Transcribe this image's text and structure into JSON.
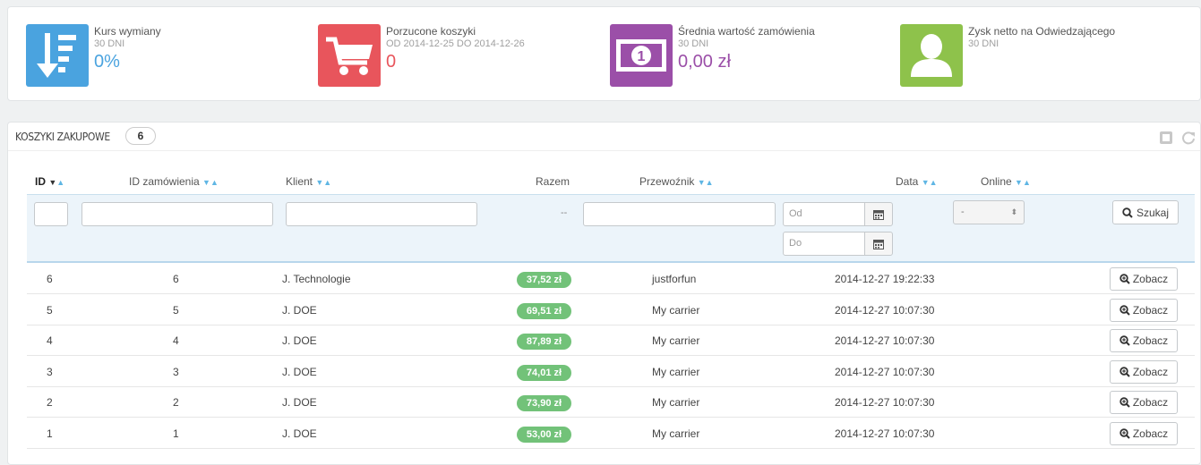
{
  "kpis": [
    {
      "title": "Kurs wymiany",
      "sub": "30 DNI",
      "value": "0%",
      "icon": "sort-down-icon",
      "color": "#4aa3df"
    },
    {
      "title": "Porzucone koszyki",
      "sub": "OD 2014-12-25 DO 2014-12-26",
      "value": "0",
      "icon": "shopping-cart-icon",
      "color": "#e8555c"
    },
    {
      "title": "Średnia wartość zamówienia",
      "sub": "30 DNI",
      "value": "0,00 zł",
      "icon": "money-icon",
      "color": "#9b4fa8"
    },
    {
      "title": "Zysk netto na Odwiedzającego",
      "sub": "30 DNI",
      "value": "",
      "icon": "user-icon",
      "color": "#8ec24b"
    }
  ],
  "panel": {
    "title": "KOSZYKI ZAKUPOWE",
    "count": "6"
  },
  "columns": {
    "id": "ID",
    "order_id": "ID zamówienia",
    "customer": "Klient",
    "total": "Razem",
    "carrier": "Przewoźnik",
    "date": "Data",
    "online": "Online"
  },
  "filters": {
    "date_from_placeholder": "Od",
    "date_to_placeholder": "Do",
    "online_value": "-",
    "total_dash": "--",
    "search_label": "Szukaj"
  },
  "view_label": "Zobacz",
  "rows": [
    {
      "id": "6",
      "order_id": "6",
      "customer": "J. Technologie",
      "total": "37,52 zł",
      "carrier": "justforfun",
      "date": "2014-12-27 19:22:33"
    },
    {
      "id": "5",
      "order_id": "5",
      "customer": "J. DOE",
      "total": "69,51 zł",
      "carrier": "My carrier",
      "date": "2014-12-27 10:07:30"
    },
    {
      "id": "4",
      "order_id": "4",
      "customer": "J. DOE",
      "total": "87,89 zł",
      "carrier": "My carrier",
      "date": "2014-12-27 10:07:30"
    },
    {
      "id": "3",
      "order_id": "3",
      "customer": "J. DOE",
      "total": "74,01 zł",
      "carrier": "My carrier",
      "date": "2014-12-27 10:07:30"
    },
    {
      "id": "2",
      "order_id": "2",
      "customer": "J. DOE",
      "total": "73,90 zł",
      "carrier": "My carrier",
      "date": "2014-12-27 10:07:30"
    },
    {
      "id": "1",
      "order_id": "1",
      "customer": "J. DOE",
      "total": "53,00 zł",
      "carrier": "My carrier",
      "date": "2014-12-27 10:07:30"
    }
  ]
}
